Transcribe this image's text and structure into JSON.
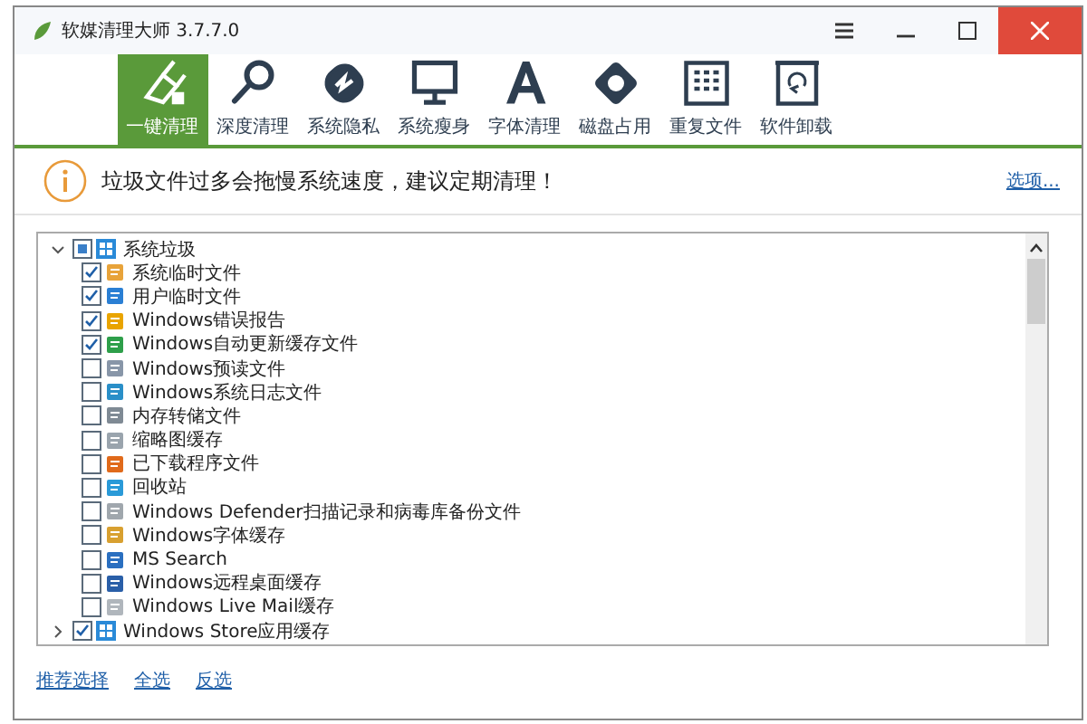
{
  "window": {
    "title": "软媒清理大师 3.7.7.0"
  },
  "tabs": [
    {
      "label": "一键清理",
      "selected": true
    },
    {
      "label": "深度清理",
      "selected": false
    },
    {
      "label": "系统隐私",
      "selected": false
    },
    {
      "label": "系统瘦身",
      "selected": false
    },
    {
      "label": "字体清理",
      "selected": false
    },
    {
      "label": "磁盘占用",
      "selected": false
    },
    {
      "label": "重复文件",
      "selected": false
    },
    {
      "label": "软件卸载",
      "selected": false
    }
  ],
  "notice": {
    "message": "垃圾文件过多会拖慢系统速度，建议定期清理！",
    "options_link": "选项..."
  },
  "tree": [
    {
      "label": "系统垃圾",
      "checked": false,
      "partial": true,
      "expanded": true,
      "children": [
        {
          "label": "系统临时文件",
          "checked": true,
          "partial": false
        },
        {
          "label": "用户临时文件",
          "checked": true,
          "partial": false
        },
        {
          "label": "Windows错误报告",
          "checked": true,
          "partial": false
        },
        {
          "label": "Windows自动更新缓存文件",
          "checked": true,
          "partial": false
        },
        {
          "label": "Windows预读文件",
          "checked": false,
          "partial": false
        },
        {
          "label": "Windows系统日志文件",
          "checked": false,
          "partial": false
        },
        {
          "label": "内存转储文件",
          "checked": false,
          "partial": false
        },
        {
          "label": "缩略图缓存",
          "checked": false,
          "partial": false
        },
        {
          "label": "已下载程序文件",
          "checked": false,
          "partial": false
        },
        {
          "label": "回收站",
          "checked": false,
          "partial": false
        },
        {
          "label": "Windows Defender扫描记录和病毒库备份文件",
          "checked": false,
          "partial": false
        },
        {
          "label": "Windows字体缓存",
          "checked": false,
          "partial": false
        },
        {
          "label": "MS Search",
          "checked": false,
          "partial": false
        },
        {
          "label": "Windows远程桌面缓存",
          "checked": false,
          "partial": false
        },
        {
          "label": "Windows Live Mail缓存",
          "checked": false,
          "partial": false
        }
      ]
    },
    {
      "label": "Windows Store应用缓存",
      "checked": true,
      "partial": false,
      "expanded": false
    }
  ],
  "footer_links": [
    "推荐选择",
    "全选",
    "反选"
  ]
}
